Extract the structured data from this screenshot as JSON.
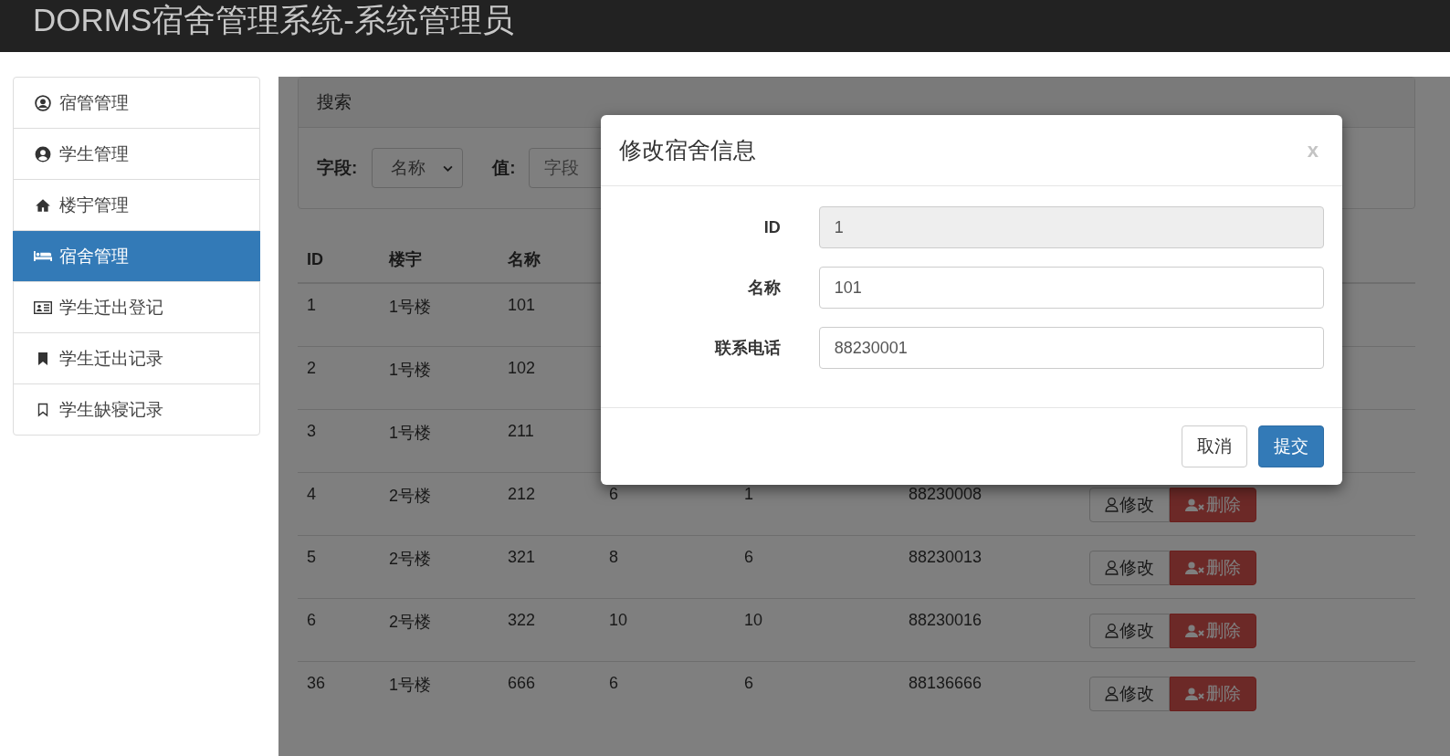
{
  "header": {
    "title": "DORMS宿舍管理系统-系统管理员"
  },
  "sidebar": {
    "items": [
      {
        "label": "宿管管理",
        "selected": false
      },
      {
        "label": "学生管理",
        "selected": false
      },
      {
        "label": "楼宇管理",
        "selected": false
      },
      {
        "label": "宿舍管理",
        "selected": true
      },
      {
        "label": "学生迁出登记",
        "selected": false
      },
      {
        "label": "学生迁出记录",
        "selected": false
      },
      {
        "label": "学生缺寝记录",
        "selected": false
      }
    ]
  },
  "search": {
    "heading": "搜索",
    "field_label": "字段:",
    "field_value": "名称",
    "value_label": "值:",
    "value_placeholder": "字段"
  },
  "table": {
    "columns": [
      "ID",
      "楼宇",
      "名称"
    ],
    "rows": [
      {
        "cells": [
          "1",
          "1号楼",
          "101"
        ]
      },
      {
        "cells": [
          "2",
          "1号楼",
          "102"
        ]
      },
      {
        "cells": [
          "3",
          "1号楼",
          "211"
        ]
      },
      {
        "cells": [
          "4",
          "2号楼",
          "212",
          "6",
          "1",
          "88230008"
        ],
        "actions": {
          "edit": "修改",
          "delete": "删除"
        }
      },
      {
        "cells": [
          "5",
          "2号楼",
          "321",
          "8",
          "6",
          "88230013"
        ],
        "actions": {
          "edit": "修改",
          "delete": "删除"
        }
      },
      {
        "cells": [
          "6",
          "2号楼",
          "322",
          "10",
          "10",
          "88230016"
        ],
        "actions": {
          "edit": "修改",
          "delete": "删除"
        }
      },
      {
        "cells": [
          "36",
          "1号楼",
          "666",
          "6",
          "6",
          "88136666"
        ],
        "actions": {
          "edit": "修改",
          "delete": "删除"
        }
      }
    ]
  },
  "modal": {
    "title": "修改宿舍信息",
    "close": "x",
    "fields": [
      {
        "label": "ID",
        "value": "1",
        "disabled": true
      },
      {
        "label": "名称",
        "value": "101",
        "disabled": false
      },
      {
        "label": "联系电话",
        "value": "88230001",
        "disabled": false
      }
    ],
    "buttons": [
      {
        "label": "取消",
        "kind": "default"
      },
      {
        "label": "提交",
        "kind": "primary"
      }
    ]
  }
}
